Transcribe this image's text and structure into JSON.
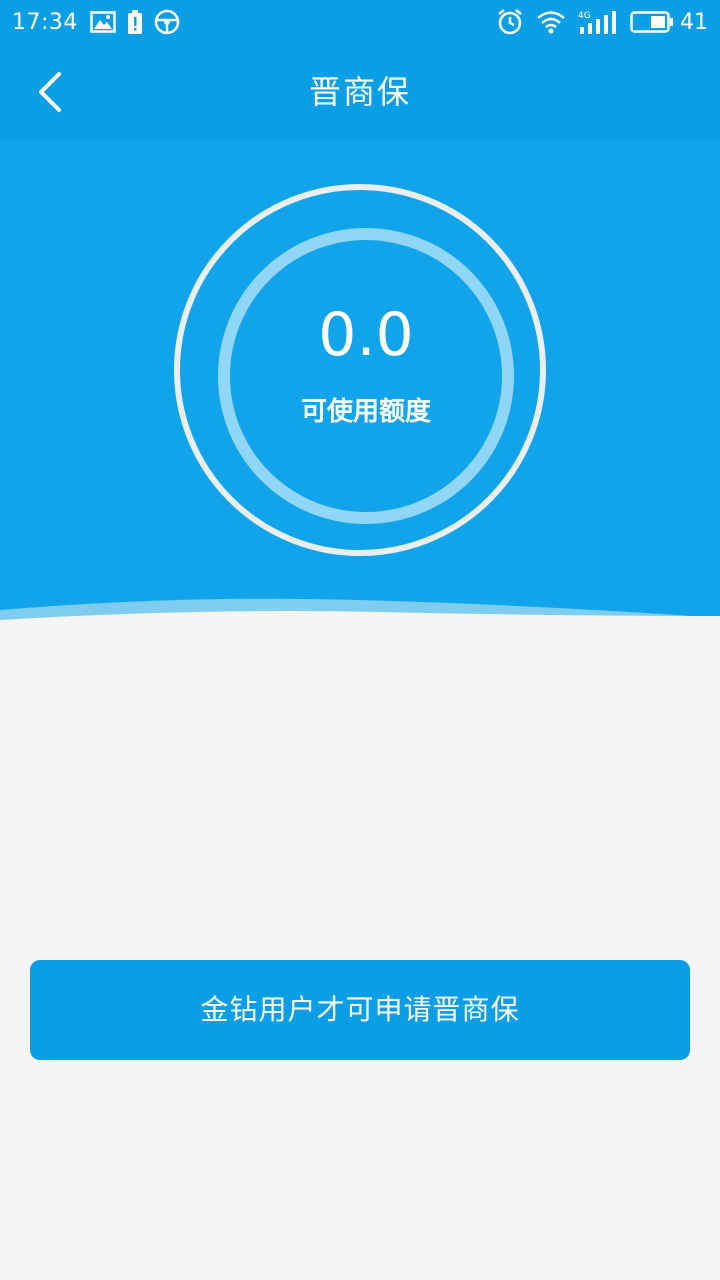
{
  "status_bar": {
    "time": "17:34",
    "battery_level": "41",
    "icons_left": [
      "image-icon",
      "battery-alert-icon",
      "steering-wheel-icon"
    ],
    "icons_right": [
      "alarm-icon",
      "wifi-icon",
      "signal-4g-icon",
      "battery-icon"
    ],
    "network_label": "4G"
  },
  "nav": {
    "title": "晋商保",
    "back_icon": "chevron-left-icon"
  },
  "gauge": {
    "value": "0.0",
    "label": "可使用额度"
  },
  "action": {
    "button_label": "金钻用户才可申请晋商保"
  },
  "colors": {
    "header": "#0a9ee6",
    "hero": "#12a4ea",
    "ring_outer": "#e8eef2",
    "ring_inner": "#8fd6f7",
    "page_background": "#f5f5f5",
    "button": "#0a9ee6"
  }
}
